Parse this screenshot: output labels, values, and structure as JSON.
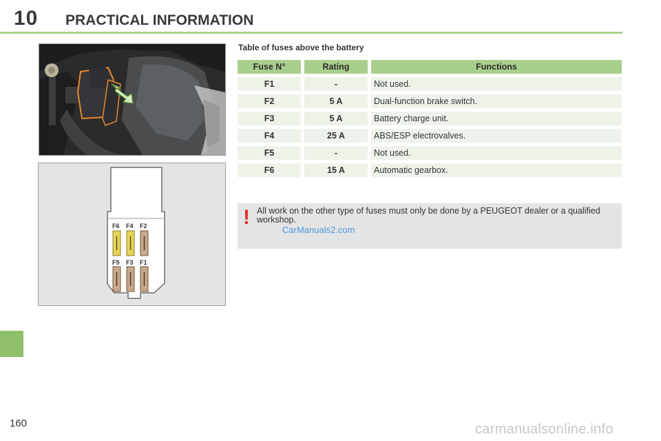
{
  "header": {
    "chapter_number": "10",
    "title": "PRACTICAL INFORMATION"
  },
  "fuse_section": {
    "title": "Table of fuses above the battery",
    "columns": [
      "Fuse N°",
      "Rating",
      "Functions"
    ],
    "rows": [
      {
        "fuse": "F1",
        "rating": "-",
        "function": "Not used."
      },
      {
        "fuse": "F2",
        "rating": "5 A",
        "function": "Dual-function brake switch."
      },
      {
        "fuse": "F3",
        "rating": "5 A",
        "function": "Battery charge unit."
      },
      {
        "fuse": "F4",
        "rating": "25 A",
        "function": "ABS/ESP electrovalves."
      },
      {
        "fuse": "F5",
        "rating": "-",
        "function": "Not used."
      },
      {
        "fuse": "F6",
        "rating": "15 A",
        "function": "Automatic gearbox."
      }
    ]
  },
  "diagram": {
    "top_labels": [
      "F6",
      "F4",
      "F2"
    ],
    "bottom_labels": [
      "F5",
      "F3",
      "F1"
    ]
  },
  "warning": {
    "icon": "exclamation-icon",
    "text": "All work on the other type of fuses must only be done by a PEUGEOT dealer or a qualified workshop."
  },
  "watermarks": {
    "top": "CarManuals2.com",
    "bottom": "carmanualsonline.info"
  },
  "page_number": "160",
  "colors": {
    "accent_green": "#a9cf8d",
    "side_tab": "#8fc06a",
    "row_background": "#eef3ea",
    "warning_red": "#e2312c",
    "highlight_orange": "#e8892b"
  }
}
